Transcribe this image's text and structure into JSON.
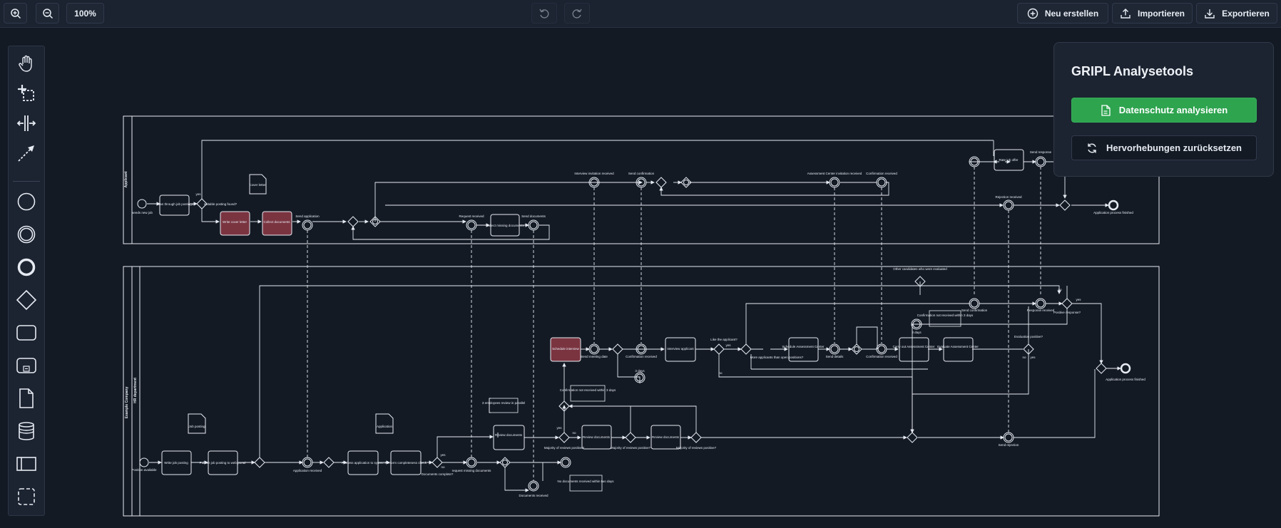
{
  "toolbar": {
    "zoom_in_icon": "zoom-in-icon",
    "zoom_out_icon": "zoom-out-icon",
    "zoom_level": "100%",
    "new_label": "Neu erstellen",
    "import_label": "Importieren",
    "export_label": "Exportieren"
  },
  "panel": {
    "title": "GRIPL Analysetools",
    "analyze_label": "Datenschutz analysieren",
    "reset_label": "Hervorhebungen zurücksetzen"
  },
  "colors": {
    "background": "#141a24",
    "accent_green": "#2ea44f",
    "highlight_task": "#7a3440"
  },
  "diagram": {
    "pool_top": "Applicant",
    "pool_bottom": "Example Company",
    "lane_bottom": "HR department",
    "labels": {
      "needs_new_job": "Needs new job",
      "scan_postings": "Scan through job postings",
      "suitable_found": "suitable posting found?",
      "cover_letter": "Cover letter",
      "write_cover": "Write cover letter",
      "collect_docs": "Collect documents",
      "send_application": "Send application",
      "request_received": "Request received",
      "collect_missing": "Collect missing documents",
      "send_documents": "Send documents",
      "interview_invitation": "Interview invitation received",
      "send_confirmation": "Send confirmation",
      "assessment_invitation": "Assessment Center invitation received",
      "confirmation_received_top": "Confirmation received",
      "rate_offer": "Rate job offer",
      "send_response": "Send response",
      "rejection_received": "Rejection received",
      "application_finished_top": "Application process finished",
      "position_available": "Position available",
      "job_posting": "Job posting",
      "write_posting": "Write job posting",
      "publish_posting": "Publish job posting to web portal",
      "application_received": "Application received",
      "application": "Application",
      "process_application": "Process application to system",
      "completeness_check": "Perform completeness check",
      "documents_complete": "Documents complete?",
      "request_missing": "request missing documents",
      "documents_received": "Documents received",
      "no_documents_note": "No documents received within two days",
      "three_employees_note": "3 employees review in parallel",
      "review_documents": "Review documents",
      "majority_positive": "Majority of reviews positive?",
      "schedule_interview": "Schedule interview",
      "send_meeting_date": "Send meeting date",
      "confirmation_received": "Confirmation received",
      "three_days": "3 days",
      "no_confirmation_note": "Confirmation not received within 3 days",
      "interview_applicant": "Interview applicant",
      "like_applicant": "Like the applicant?",
      "more_applicants": "More applicants than open positions?",
      "schedule_assessment": "Schedule Assessment Center",
      "send_details": "Send details",
      "carry_out_assessment": "Carry out Assessment Center",
      "evaluate_assessment": "Evaluate Assessment Center",
      "evaluation_positive": "Evaluation positive?",
      "other_candidates": "Other candidates who were evaluated",
      "send_confirmation_bottom": "Send confirmation",
      "response_received": "Response received",
      "positive_response": "Positive response?",
      "send_rejection": "Send rejection",
      "application_finished_bottom": "Application process finished",
      "yes": "yes",
      "no": "no"
    }
  }
}
